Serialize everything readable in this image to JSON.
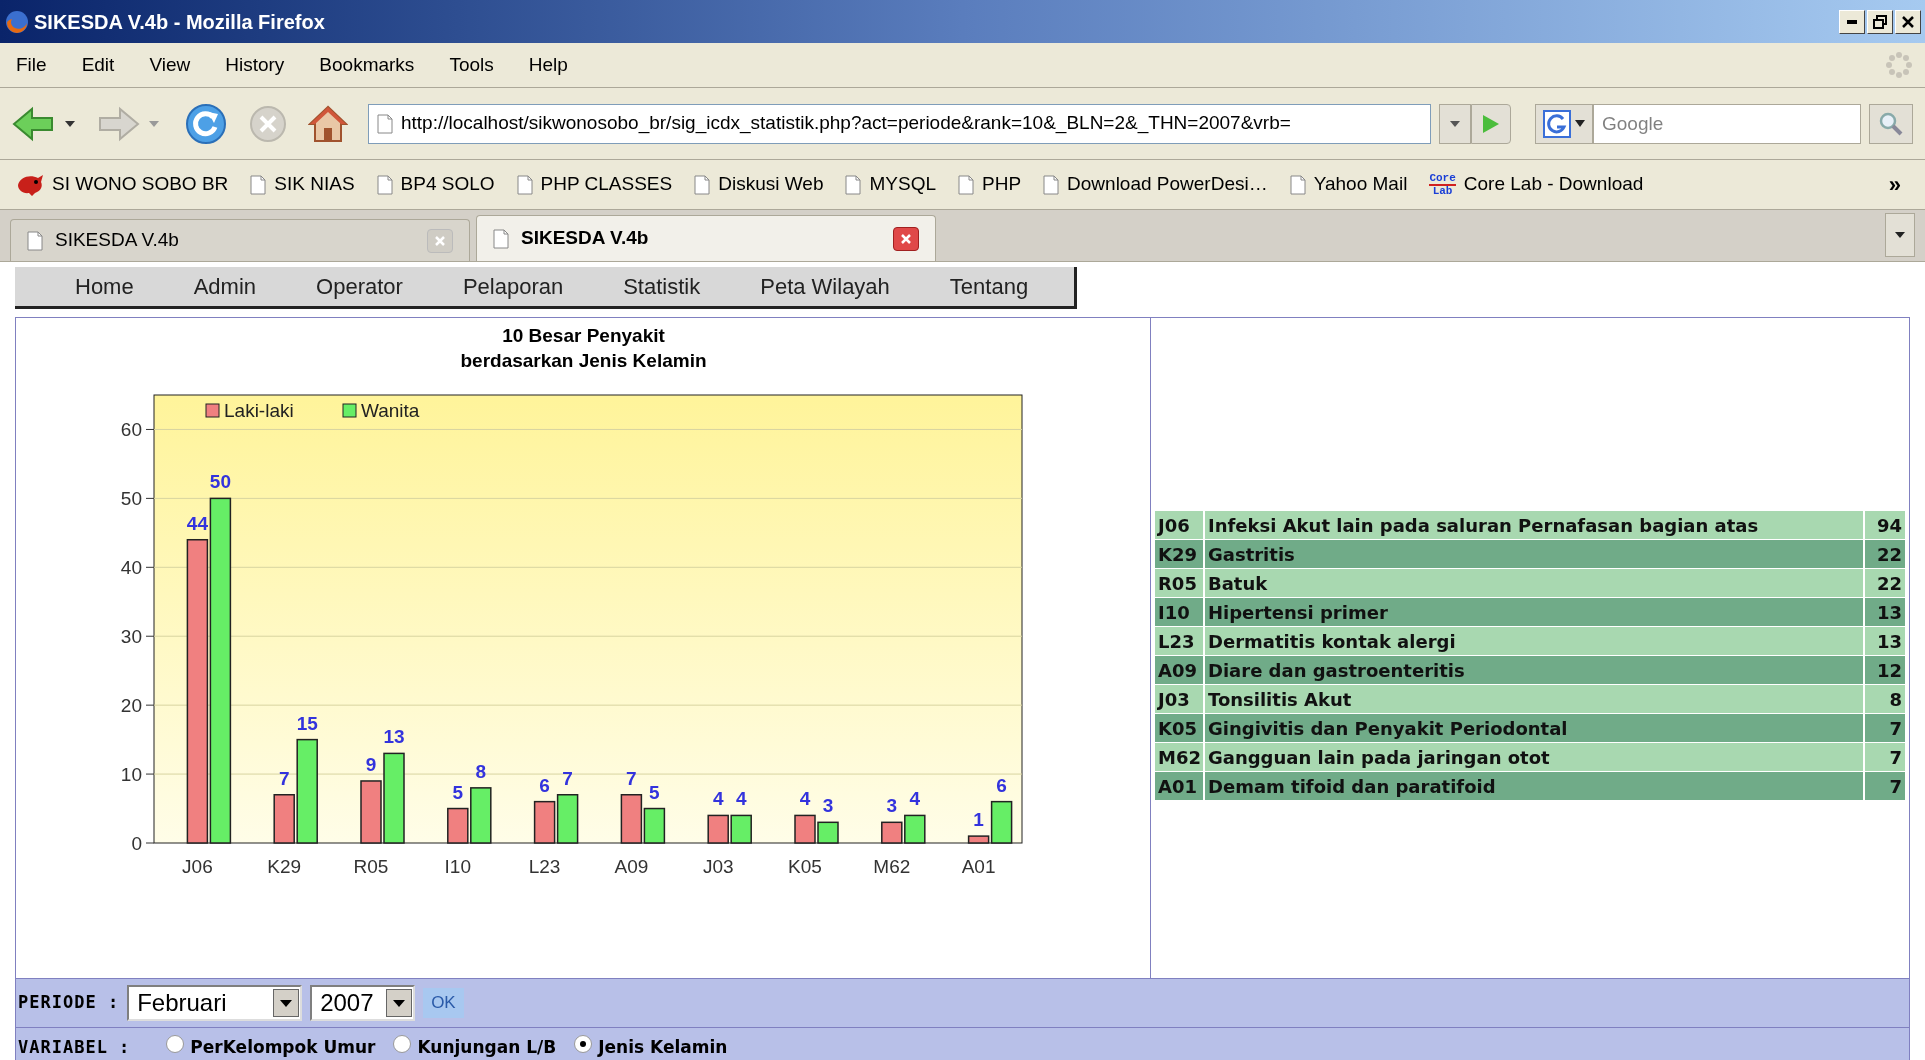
{
  "window": {
    "title": "SIKESDA V.4b - Mozilla Firefox"
  },
  "menu": [
    "File",
    "Edit",
    "View",
    "History",
    "Bookmarks",
    "Tools",
    "Help"
  ],
  "address_bar": {
    "value": "http://localhost/sikwonosobo_br/sig_icdx_statistik.php?act=periode&rank=10&_BLN=2&_THN=2007&vrb="
  },
  "search": {
    "placeholder": "Google"
  },
  "bookmarks": [
    {
      "label": "SI WONO SOBO BR",
      "kind": "site"
    },
    {
      "label": "SIK NIAS",
      "kind": "page"
    },
    {
      "label": "BP4 SOLO",
      "kind": "page"
    },
    {
      "label": "PHP CLASSES",
      "kind": "page"
    },
    {
      "label": "Diskusi Web",
      "kind": "page"
    },
    {
      "label": "MYSQL",
      "kind": "page"
    },
    {
      "label": "PHP",
      "kind": "page"
    },
    {
      "label": "Download PowerDesi…",
      "kind": "page"
    },
    {
      "label": "Yahoo Mail",
      "kind": "page"
    },
    {
      "label": "Core Lab - Download",
      "kind": "logo",
      "icon_text": [
        "Core",
        "Lab"
      ]
    }
  ],
  "bookmarks_overflow": "»",
  "tabs": [
    {
      "label": "SIKESDA V.4b",
      "selected": false
    },
    {
      "label": "SIKESDA V.4b",
      "selected": true
    }
  ],
  "site_nav": [
    "Home",
    "Admin",
    "Operator",
    "Pelaporan",
    "Statistik",
    "Peta Wilayah",
    "Tentang"
  ],
  "chart_data": {
    "type": "bar",
    "title": "10 Besar Penyakit\nberdasarkan Jenis Kelamin",
    "categories": [
      "J06",
      "K29",
      "R05",
      "I10",
      "L23",
      "A09",
      "J03",
      "K05",
      "M62",
      "A01"
    ],
    "series": [
      {
        "name": "Laki-laki",
        "color": "#f08080",
        "values": [
          44,
          7,
          9,
          5,
          6,
          7,
          4,
          4,
          3,
          1
        ]
      },
      {
        "name": "Wanita",
        "color": "#66ee66",
        "values": [
          50,
          15,
          13,
          8,
          7,
          5,
          4,
          3,
          4,
          6
        ]
      }
    ],
    "legend": true,
    "grid": true,
    "ylim": [
      0,
      65
    ],
    "yticks": [
      0,
      10,
      20,
      30,
      40,
      50,
      60
    ],
    "data_labels": true
  },
  "table": {
    "rows": [
      {
        "code": "J06",
        "name": "Infeksi Akut lain pada saluran Pernafasan bagian atas",
        "count": "94"
      },
      {
        "code": "K29",
        "name": "Gastritis",
        "count": "22"
      },
      {
        "code": "R05",
        "name": "Batuk",
        "count": "22"
      },
      {
        "code": "I10",
        "name": "Hipertensi primer",
        "count": "13"
      },
      {
        "code": "L23",
        "name": "Dermatitis kontak alergi",
        "count": "13"
      },
      {
        "code": "A09",
        "name": "Diare dan gastroenteritis",
        "count": "12"
      },
      {
        "code": "J03",
        "name": "Tonsilitis Akut",
        "count": "8"
      },
      {
        "code": "K05",
        "name": "Gingivitis dan Penyakit Periodontal",
        "count": "7"
      },
      {
        "code": "M62",
        "name": "Gangguan lain pada jaringan otot",
        "count": "7"
      },
      {
        "code": "A01",
        "name": "Demam tifoid dan paratifoid",
        "count": "7"
      }
    ]
  },
  "periode": {
    "label": "PERIODE :",
    "month": "Februari",
    "year": "2007",
    "button": "OK"
  },
  "variabel": {
    "label": "VARIABEL :",
    "options": [
      {
        "label": "PerKelompok Umur",
        "selected": false
      },
      {
        "label": "Kunjungan L/B",
        "selected": false
      },
      {
        "label": "Jenis Kelamin",
        "selected": true
      }
    ]
  }
}
